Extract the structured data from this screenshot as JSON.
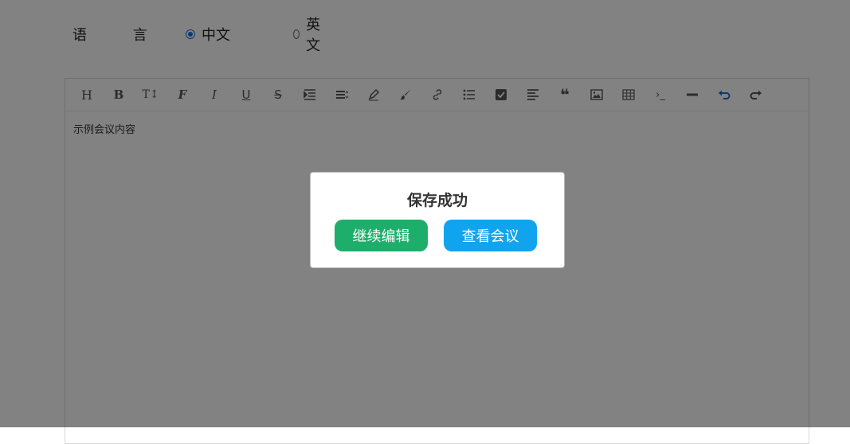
{
  "language": {
    "label": "语 言",
    "options": [
      {
        "label": "中文",
        "selected": true
      },
      {
        "label": "英文",
        "selected": false
      }
    ],
    "accent": "#1f6fd6"
  },
  "editor": {
    "toolbar": [
      {
        "name": "heading-icon",
        "glyph": "H"
      },
      {
        "name": "bold-icon",
        "glyph": "B"
      },
      {
        "name": "font-size-icon",
        "glyph": "T↕"
      },
      {
        "name": "font-family-icon",
        "glyph": "F"
      },
      {
        "name": "italic-icon",
        "glyph": "I"
      },
      {
        "name": "underline-icon",
        "glyph": "U"
      },
      {
        "name": "strikethrough-icon",
        "glyph": "S"
      },
      {
        "name": "indent-icon",
        "glyph": "indent"
      },
      {
        "name": "line-height-icon",
        "glyph": "lineheight"
      },
      {
        "name": "font-color-icon",
        "glyph": "pen"
      },
      {
        "name": "background-color-icon",
        "glyph": "brush"
      },
      {
        "name": "link-icon",
        "glyph": "link"
      },
      {
        "name": "list-icon",
        "glyph": "list"
      },
      {
        "name": "todo-icon",
        "glyph": "check"
      },
      {
        "name": "justify-icon",
        "glyph": "align"
      },
      {
        "name": "quote-icon",
        "glyph": "❝"
      },
      {
        "name": "image-icon",
        "glyph": "image"
      },
      {
        "name": "table-icon",
        "glyph": "table"
      },
      {
        "name": "code-icon",
        "glyph": "code"
      },
      {
        "name": "divider-icon",
        "glyph": "hr"
      },
      {
        "name": "undo-icon",
        "glyph": "undo"
      },
      {
        "name": "redo-icon",
        "glyph": "redo"
      }
    ],
    "content": "示例会议内容"
  },
  "modal": {
    "title": "保存成功",
    "continue_label": "继续编辑",
    "view_label": "查看会议",
    "continue_color": "#1eae6b",
    "view_color": "#10a4ef"
  }
}
